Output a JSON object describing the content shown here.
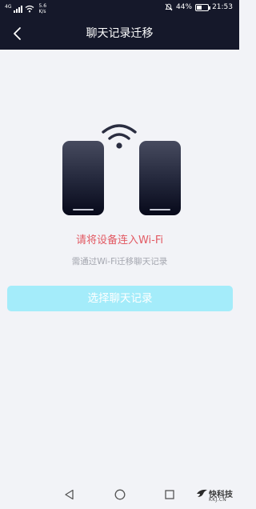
{
  "status_bar": {
    "network_label": "4G",
    "speed_value": "5.6",
    "speed_unit": "K/s",
    "battery": "44%",
    "battery_level": 0.44,
    "time": "21:53"
  },
  "header": {
    "title": "聊天记录迁移"
  },
  "main": {
    "headline": "请将设备连入Wi-Fi",
    "subtext": "需通过Wi-Fi迁移聊天记录",
    "primary_button": "选择聊天记录"
  },
  "watermark": {
    "main": "快科技",
    "sub": "KKJ.CN"
  },
  "colors": {
    "header_bg": "#15182a",
    "page_bg": "#f2f3f7",
    "headline": "#e25a63",
    "subtext": "#a3a5ae",
    "button_bg": "#a4ecfa"
  },
  "icons": [
    "signal-icon",
    "wifi-icon",
    "mute-icon",
    "battery-icon",
    "back-arrow-icon",
    "phone-icon",
    "wifi-large-icon",
    "nav-back-icon",
    "nav-home-icon",
    "nav-recent-icon"
  ]
}
